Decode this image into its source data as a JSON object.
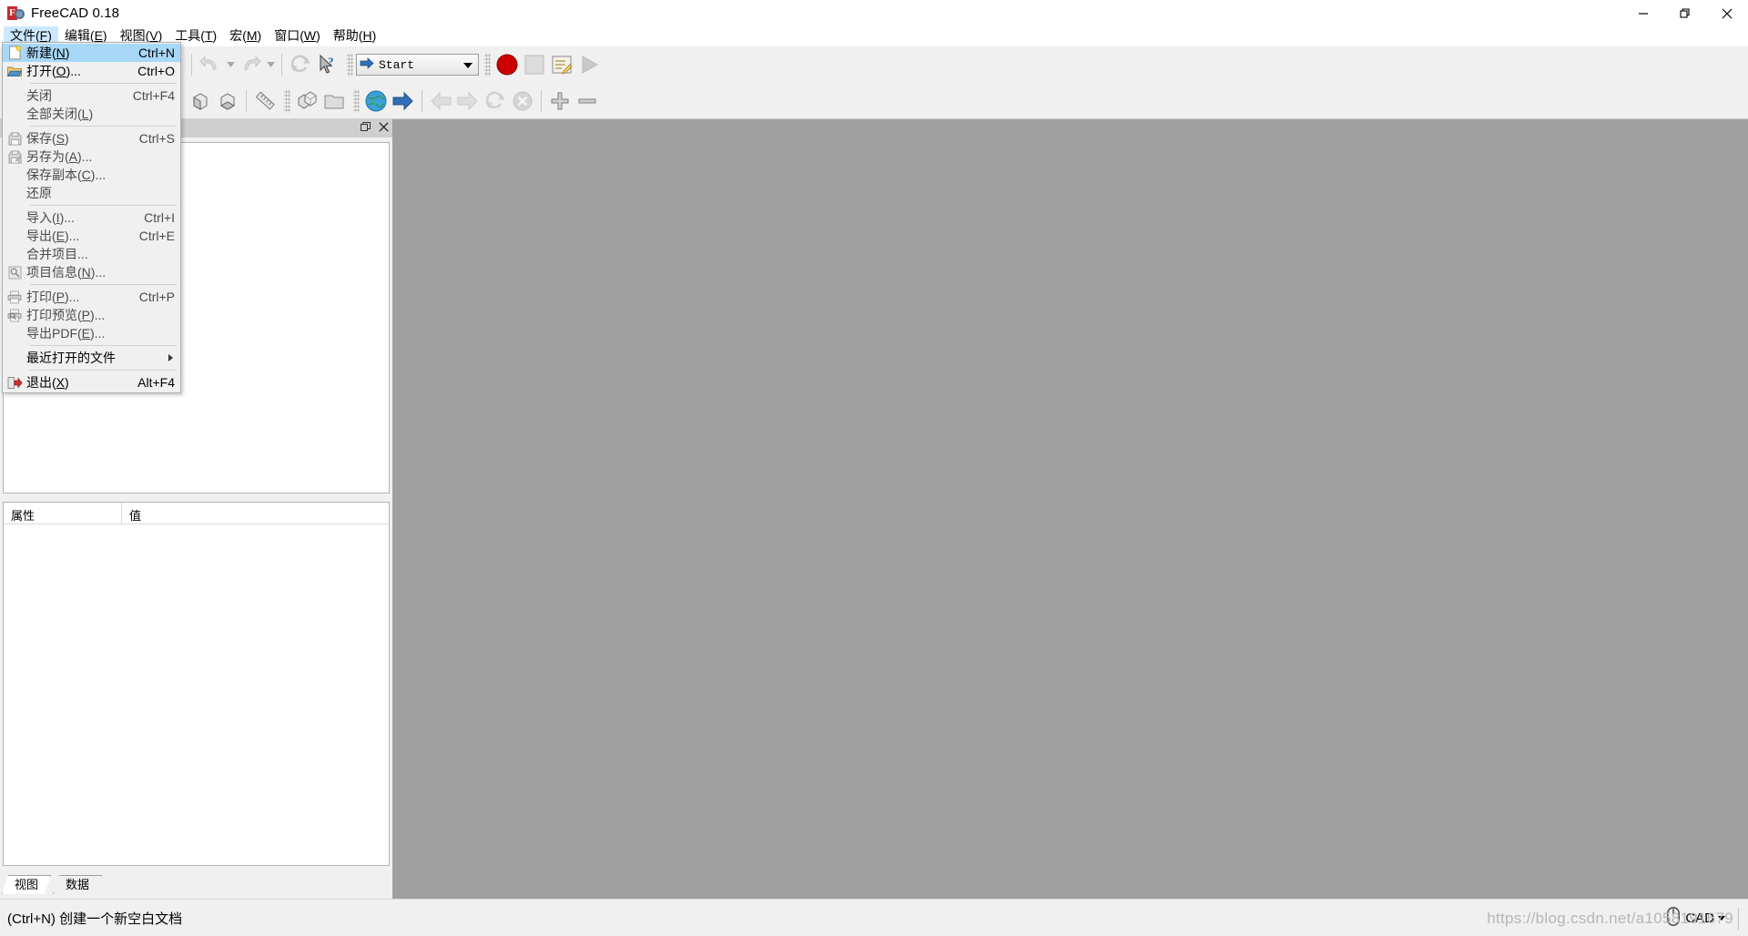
{
  "window": {
    "title": "FreeCAD 0.18",
    "logo_icon": "freecad-logo-icon",
    "minimize_label": "—",
    "restore_label": "❐",
    "close_label": "✕",
    "minimize_name": "minimize-button",
    "restore_name": "restore-button",
    "close_name": "close-button"
  },
  "menubar": {
    "items": [
      {
        "text": "文件(F)",
        "pre": "文件(",
        "key": "F",
        "post": ")",
        "name": "menu-file",
        "active": true
      },
      {
        "text": "编辑(E)",
        "pre": "编辑(",
        "key": "E",
        "post": ")",
        "name": "menu-edit",
        "active": false
      },
      {
        "text": "视图(V)",
        "pre": "视图(",
        "key": "V",
        "post": ")",
        "name": "menu-view",
        "active": false
      },
      {
        "text": "工具(T)",
        "pre": "工具(",
        "key": "T",
        "post": ")",
        "name": "menu-tools",
        "active": false
      },
      {
        "text": "宏(M)",
        "pre": "宏(",
        "key": "M",
        "post": ")",
        "name": "menu-macro",
        "active": false
      },
      {
        "text": "窗口(W)",
        "pre": "窗口(",
        "key": "W",
        "post": ")",
        "name": "menu-window",
        "active": false
      },
      {
        "text": "帮助(H)",
        "pre": "帮助(",
        "key": "H",
        "post": ")",
        "name": "menu-help",
        "active": false
      }
    ]
  },
  "file_menu": {
    "items": [
      {
        "label": "新建(N)",
        "pre": "新建(",
        "key": "N",
        "post": ")",
        "shortcut": "Ctrl+N",
        "icon": "new-document-icon",
        "enabled": true,
        "highlighted": true,
        "name": "file-menu-new"
      },
      {
        "label": "打开(O)...",
        "pre": "打开(",
        "key": "O",
        "post": ")...",
        "shortcut": "Ctrl+O",
        "icon": "open-folder-icon",
        "enabled": true,
        "highlighted": false,
        "name": "file-menu-open"
      },
      {
        "separator": true,
        "name": "file-menu-separator-1"
      },
      {
        "label": "关闭",
        "pre": "关闭",
        "key": "",
        "post": "",
        "shortcut": "Ctrl+F4",
        "icon": "",
        "enabled": false,
        "highlighted": false,
        "name": "file-menu-close"
      },
      {
        "label": "全部关闭(L)",
        "pre": "全部关闭(",
        "key": "L",
        "post": ")",
        "shortcut": "",
        "icon": "",
        "enabled": false,
        "highlighted": false,
        "name": "file-menu-close-all"
      },
      {
        "separator": true,
        "name": "file-menu-separator-2"
      },
      {
        "label": "保存(S)",
        "pre": "保存(",
        "key": "S",
        "post": ")",
        "shortcut": "Ctrl+S",
        "icon": "save-icon",
        "enabled": false,
        "highlighted": false,
        "name": "file-menu-save"
      },
      {
        "label": "另存为(A)...",
        "pre": "另存为(",
        "key": "A",
        "post": ")...",
        "shortcut": "",
        "icon": "save-as-icon",
        "enabled": false,
        "highlighted": false,
        "name": "file-menu-save-as"
      },
      {
        "label": "保存副本(C)...",
        "pre": "保存副本(",
        "key": "C",
        "post": ")...",
        "shortcut": "",
        "icon": "",
        "enabled": false,
        "highlighted": false,
        "name": "file-menu-save-copy"
      },
      {
        "label": "还原",
        "pre": "还原",
        "key": "",
        "post": "",
        "shortcut": "",
        "icon": "",
        "enabled": false,
        "highlighted": false,
        "name": "file-menu-revert"
      },
      {
        "separator": true,
        "name": "file-menu-separator-3"
      },
      {
        "label": "导入(I)...",
        "pre": "导入(",
        "key": "I",
        "post": ")...",
        "shortcut": "Ctrl+I",
        "icon": "",
        "enabled": false,
        "highlighted": false,
        "name": "file-menu-import"
      },
      {
        "label": "导出(E)...",
        "pre": "导出(",
        "key": "E",
        "post": ")...",
        "shortcut": "Ctrl+E",
        "icon": "",
        "enabled": false,
        "highlighted": false,
        "name": "file-menu-export"
      },
      {
        "label": "合并项目...",
        "pre": "合并项目...",
        "key": "",
        "post": "",
        "shortcut": "",
        "icon": "",
        "enabled": false,
        "highlighted": false,
        "name": "file-menu-merge-project"
      },
      {
        "label": "项目信息(N)...",
        "pre": "项目信息(",
        "key": "N",
        "post": ")...",
        "shortcut": "",
        "icon": "project-info-icon",
        "enabled": false,
        "highlighted": false,
        "name": "file-menu-project-info"
      },
      {
        "separator": true,
        "name": "file-menu-separator-4"
      },
      {
        "label": "打印(P)...",
        "pre": "打印(",
        "key": "P",
        "post": ")...",
        "shortcut": "Ctrl+P",
        "icon": "print-icon",
        "enabled": false,
        "highlighted": false,
        "name": "file-menu-print"
      },
      {
        "label": "打印预览(P)...",
        "pre": "打印预览(",
        "key": "P",
        "post": ")...",
        "shortcut": "",
        "icon": "print-preview-icon",
        "enabled": false,
        "highlighted": false,
        "name": "file-menu-print-preview"
      },
      {
        "label": "导出PDF(E)...",
        "pre": "导出PDF(",
        "key": "E",
        "post": ")...",
        "shortcut": "",
        "icon": "",
        "enabled": false,
        "highlighted": false,
        "name": "file-menu-export-pdf"
      },
      {
        "separator": true,
        "name": "file-menu-separator-5"
      },
      {
        "label": "最近打开的文件",
        "pre": "最近打开的文件",
        "key": "",
        "post": "",
        "shortcut": "",
        "icon": "",
        "enabled": true,
        "highlighted": false,
        "submenu": true,
        "name": "file-menu-recent-files"
      },
      {
        "separator": true,
        "name": "file-menu-separator-6"
      },
      {
        "label": "退出(X)",
        "pre": "退出(",
        "key": "X",
        "post": ")",
        "shortcut": "Alt+F4",
        "icon": "exit-icon",
        "enabled": true,
        "highlighted": false,
        "name": "file-menu-exit"
      }
    ]
  },
  "toolbar": {
    "workbench": {
      "value": "Start",
      "icon": "blue-arrow-icon",
      "name": "workbench-selector"
    },
    "row1_buttons": [
      {
        "name": "new-document-button",
        "icon": "new-document-icon",
        "enabled": true
      },
      {
        "name": "open-document-button",
        "icon": "open-folder-icon",
        "enabled": true
      },
      {
        "name": "save-document-button",
        "icon": "save-icon",
        "enabled": false
      },
      {
        "name": "cut-button",
        "icon": "scissors-icon",
        "enabled": false
      },
      {
        "name": "copy-button",
        "icon": "copy-icon",
        "enabled": false
      },
      {
        "name": "paste-button",
        "icon": "clipboard-icon",
        "enabled": false
      },
      {
        "name": "undo-button",
        "icon": "undo-arrow-icon",
        "enabled": false
      },
      {
        "name": "undo-dropdown-button",
        "icon": "chevron-down-icon",
        "enabled": false
      },
      {
        "name": "redo-button",
        "icon": "redo-arrow-icon",
        "enabled": false
      },
      {
        "name": "redo-dropdown-button",
        "icon": "chevron-down-icon",
        "enabled": false
      },
      {
        "name": "refresh-button",
        "icon": "refresh-icon",
        "enabled": false
      },
      {
        "name": "whats-this-button",
        "icon": "cursor-question-icon",
        "enabled": true
      }
    ],
    "macro_buttons": [
      {
        "name": "macro-record-button",
        "icon": "record-circle-icon",
        "color": "#cc0000",
        "enabled": true
      },
      {
        "name": "macro-stop-button",
        "icon": "stop-square-icon",
        "color": "#b0b0b0",
        "enabled": false
      },
      {
        "name": "macro-edit-button",
        "icon": "macro-edit-icon",
        "color": "#d8d8d8",
        "enabled": true
      },
      {
        "name": "macro-execute-button",
        "icon": "play-triangle-icon",
        "color": "#9a9a9a",
        "enabled": false
      }
    ],
    "row2_buttons": [
      {
        "name": "fit-all-button",
        "icon": "fit-all-icon",
        "enabled": true
      },
      {
        "name": "view-fit-selection-button",
        "icon": "fit-selection-icon",
        "enabled": true
      },
      {
        "name": "axonometric-view-button",
        "icon": "axonometric-cube-icon",
        "enabled": true
      },
      {
        "name": "front-view-button",
        "icon": "front-view-cube-icon",
        "enabled": true
      },
      {
        "name": "top-view-button",
        "icon": "top-view-cube-icon",
        "enabled": true
      },
      {
        "name": "right-view-button",
        "icon": "right-view-cube-icon",
        "enabled": true
      },
      {
        "name": "rear-view-button",
        "icon": "rear-view-cube-icon",
        "enabled": true
      },
      {
        "name": "bottom-view-button",
        "icon": "bottom-view-cube-icon",
        "enabled": true
      },
      {
        "name": "measure-button",
        "icon": "ruler-icon",
        "enabled": true
      },
      {
        "name": "start-page-button",
        "icon": "boxes-icon",
        "enabled": true
      },
      {
        "name": "open-folder-row2-button",
        "icon": "folder-icon",
        "enabled": true
      },
      {
        "name": "open-website-button",
        "icon": "globe-icon",
        "enabled": true
      },
      {
        "name": "forward-arrow-button",
        "icon": "blue-arrow-icon",
        "enabled": true
      },
      {
        "name": "browser-back-button",
        "icon": "back-arrow-icon",
        "enabled": false
      },
      {
        "name": "browser-forward-button",
        "icon": "forward-arrow-icon",
        "enabled": false
      },
      {
        "name": "browser-reload-button",
        "icon": "refresh-icon",
        "enabled": false
      },
      {
        "name": "browser-stop-button",
        "icon": "stop-x-circle-icon",
        "enabled": false
      },
      {
        "name": "zoom-in-button",
        "icon": "plus-icon",
        "enabled": true
      },
      {
        "name": "zoom-out-button",
        "icon": "minus-icon",
        "enabled": true
      }
    ]
  },
  "left_dock": {
    "tree_panel": {
      "title": "",
      "float_icon": "float-panel-icon",
      "close_icon": "close-panel-icon"
    },
    "property_panel": {
      "columns": [
        "属性",
        "值"
      ],
      "rows": []
    },
    "tabs": [
      {
        "label": "视图",
        "selected": true,
        "name": "panel-tab-view"
      },
      {
        "label": "数据",
        "selected": false,
        "name": "panel-tab-data"
      }
    ]
  },
  "statusbar": {
    "message": "(Ctrl+N) 创建一个新空白文档",
    "mouse_icon": "mouse-icon",
    "nav_style": "CAD",
    "watermark": "https://blog.csdn.net/a1058191679"
  },
  "colors": {
    "menu_highlight": "#a8d8f8",
    "menubar_active": "#cce8ff",
    "toolbar_bg": "#f0f0f0",
    "mdi_bg": "#a0a0a0",
    "panel_header": "#cfcfcf",
    "record_red": "#cc0000"
  }
}
